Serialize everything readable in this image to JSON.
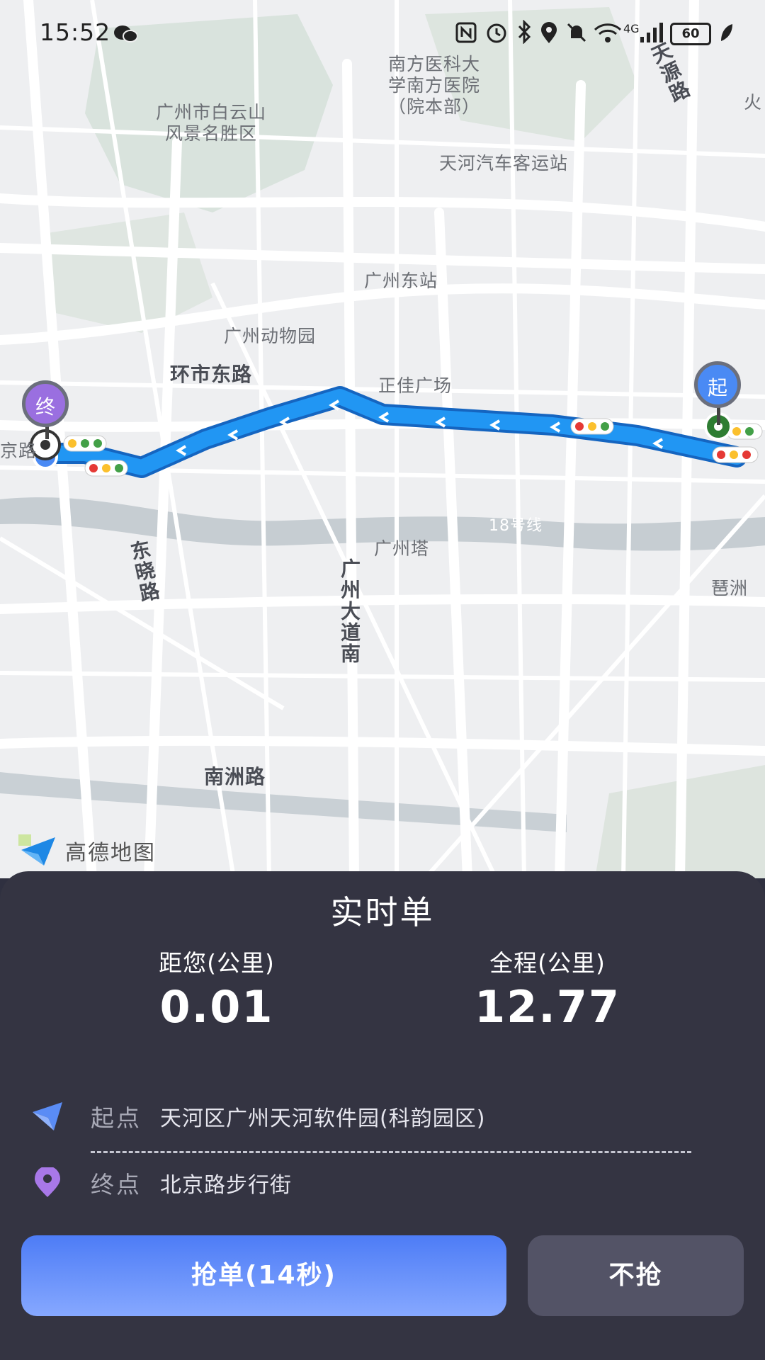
{
  "status_bar": {
    "time": "15:52",
    "battery": "60",
    "network": "4G",
    "icons": [
      "wechat-icon",
      "nfc-icon",
      "alarm-icon",
      "bluetooth-icon",
      "location-icon",
      "mute-icon",
      "wifi-icon",
      "signal-icon",
      "battery-icon",
      "leaf-icon"
    ]
  },
  "map": {
    "labels": {
      "hospital": "南方医科大\n学南方医院\n（院本部）",
      "baiyun": "广州市白云山\n风景名胜区",
      "tianyuan_road": "天源路",
      "huo": "火",
      "bus_station": "天河汽车客运站",
      "east_station": "广州东站",
      "zoo": "广州动物园",
      "huanshi_road": "环市东路",
      "zhengjia": "正佳广场",
      "canton_tower": "广州塔",
      "dongxiao_road": "东晓路",
      "guangzhou_dadao": "广州大道南",
      "pazhou": "琶洲",
      "nanzhou_road": "南洲路",
      "beijing_road_cut": "京路",
      "metro_line": "18号线"
    },
    "start_marker": "起",
    "end_marker": "终",
    "route_color": "#1e88f0",
    "logo_text": "高德地图"
  },
  "order": {
    "title": "实时单",
    "distance_label": "距您(公里)",
    "distance_value": "0.01",
    "total_label": "全程(公里)",
    "total_value": "12.77",
    "start_label": "起点",
    "start_address": "天河区广州天河软件园(科韵园区)",
    "end_label": "终点",
    "end_address": "北京路步行街",
    "grab_button": "抢单(14秒)",
    "decline_button": "不抢"
  }
}
